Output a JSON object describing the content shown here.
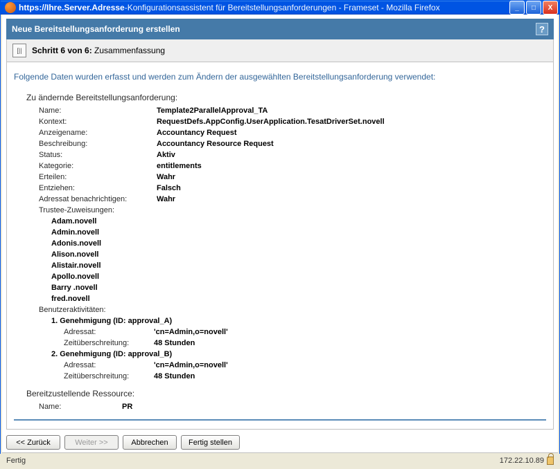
{
  "window": {
    "url": "https://Ihre.Server.Adresse",
    "title_rest": "-Konfigurationsassistent für Bereitstellungsanforderungen - Frameset - Mozilla Firefox"
  },
  "wizard": {
    "header": "Neue Bereitstellungsanforderung erstellen",
    "step_label_bold": "Schritt 6 von 6:",
    "step_label_rest": " Zusammenfassung"
  },
  "intro": "Folgende Daten wurden erfasst und werden zum Ändern der ausgewählten Bereitstellungsanforderung verwendet:",
  "section1_title": "Zu ändernde Bereitstellungsanforderung:",
  "fields": {
    "name_label": "Name:",
    "name_value": "Template2ParallelApproval_TA",
    "kontext_label": "Kontext:",
    "kontext_value": "RequestDefs.AppConfig.UserApplication.TesatDriverSet.novell",
    "anzeigename_label": "Anzeigename:",
    "anzeigename_value": "Accountancy Request",
    "beschreibung_label": "Beschreibung:",
    "beschreibung_value": "Accountancy Resource Request",
    "status_label": "Status:",
    "status_value": "Aktiv",
    "kategorie_label": "Kategorie:",
    "kategorie_value": "entitlements",
    "erteilen_label": "Erteilen:",
    "erteilen_value": "Wahr",
    "entziehen_label": "Entziehen:",
    "entziehen_value": "Falsch",
    "adressat_label": "Adressat benachrichtigen:",
    "adressat_value": "Wahr",
    "trustee_label": "Trustee-Zuweisungen:",
    "benutzer_label": "Benutzeraktivitäten:"
  },
  "trustees": [
    "Adam.novell",
    "Admin.novell",
    "Adonis.novell",
    "Alison.novell",
    "Alistair.novell",
    "Apollo.novell",
    "Barry .novell",
    "fred.novell"
  ],
  "activities": [
    {
      "title": "1. Genehmigung (ID:  approval_A)",
      "adressat_label": "Adressat:",
      "adressat_value": "'cn=Admin,o=novell'",
      "zeit_label": "Zeitüberschreitung:",
      "zeit_value": "48 Stunden"
    },
    {
      "title": "2. Genehmigung (ID:  approval_B)",
      "adressat_label": "Adressat:",
      "adressat_value": "'cn=Admin,o=novell'",
      "zeit_label": "Zeitüberschreitung:",
      "zeit_value": "48 Stunden"
    }
  ],
  "section2_title": "Bereitzustellende Ressource:",
  "resource": {
    "name_label": "Name:",
    "name_value": "PR"
  },
  "buttons": {
    "back": "<< Zurück",
    "next": "Weiter >>",
    "cancel": "Abbrechen",
    "finish": "Fertig stellen"
  },
  "statusbar": {
    "left": "Fertig",
    "right": "172.22.10.89"
  }
}
